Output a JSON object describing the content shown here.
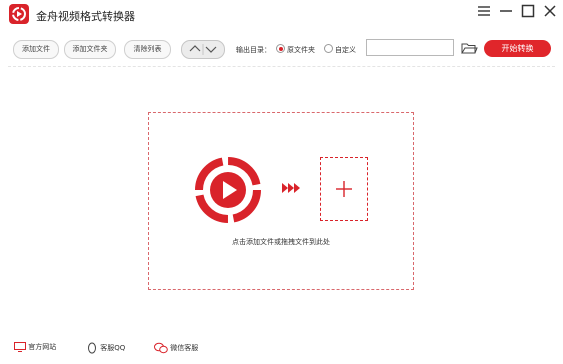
{
  "app": {
    "title": "金舟视频格式转换器",
    "brand_color": "#d9232a"
  },
  "window_controls": {
    "menu_icon": "menu-icon",
    "minimize_icon": "minimize-icon",
    "maximize_icon": "maximize-icon",
    "close_icon": "close-icon"
  },
  "toolbar": {
    "add_file": "添加文件",
    "add_folder": "添加文件夹",
    "clear_list": "清除列表",
    "output_dir_label": "输出目录：",
    "radio_original": "原文件夹",
    "radio_custom": "自定义",
    "selected_output": "原文件夹",
    "path_value": "",
    "start": "开始转换"
  },
  "drop_zone": {
    "hint": "点击添加文件或拖拽文件到此处"
  },
  "footer": {
    "website": "官方网站",
    "qq": "客服QQ",
    "wechat": "微信客服"
  }
}
